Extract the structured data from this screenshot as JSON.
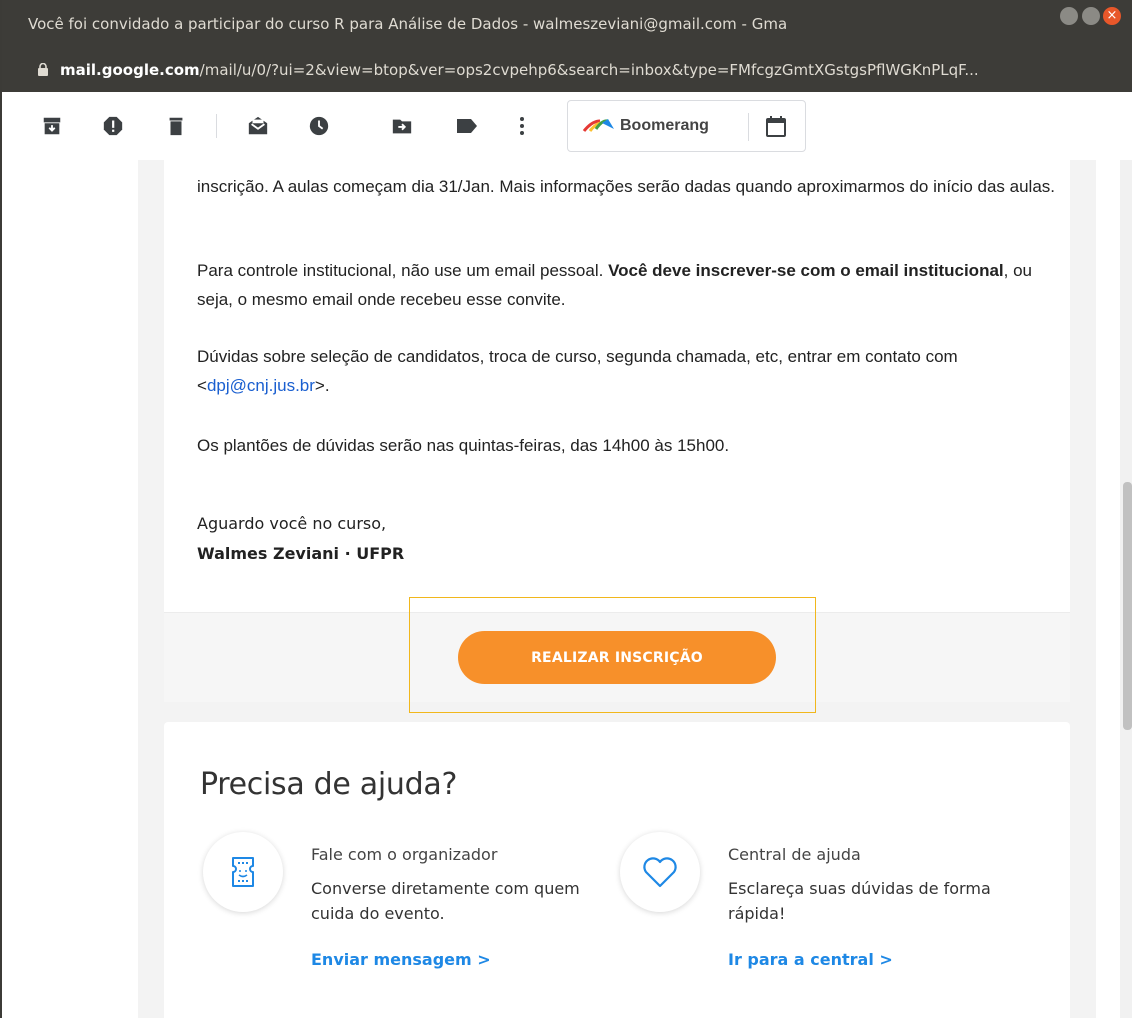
{
  "window": {
    "title": "Você foi convidado a participar do curso R para Análise de Dados - walmeszeviani@gmail.com - Gma",
    "close_glyph": "×"
  },
  "urlbar": {
    "domain": "mail.google.com",
    "path": "/mail/u/0/?ui=2&view=btop&ver=ops2cvpehp6&search=inbox&type=FMfcgzGmtXGstgsPflWGKnPLqF..."
  },
  "toolbar": {
    "icons": [
      "archive-icon",
      "report-spam-icon",
      "delete-icon",
      "mark-unread-icon",
      "snooze-icon",
      "move-to-icon",
      "label-icon",
      "more-vert-icon"
    ],
    "boomerang_label": "Boomerang"
  },
  "email": {
    "paragraph1": "inscrição. A aulas começam dia 31/Jan. Mais informações serão dadas quando aproximarmos do início das aulas.",
    "paragraph2_pre": "Para controle institucional, não use um email pessoal. ",
    "paragraph2_bold": "Você deve inscrever-se com o email institucional",
    "paragraph2_post": ", ou seja, o mesmo email onde recebeu esse convite.",
    "paragraph3_pre": "Dúvidas sobre seleção de candidatos, troca de curso, segunda chamada, etc, entrar em contato com <",
    "paragraph3_link": "dpj@cnj.jus.br",
    "paragraph3_post": ">.",
    "paragraph4": "Os plantões de dúvidas serão nas quintas-feiras, das 14h00 às 15h00.",
    "closing": "Aguardo você no curso,",
    "signature": "Walmes Zeviani · UFPR",
    "cta_label": "REALIZAR INSCRIÇÃO",
    "accent_color": "#f7902a"
  },
  "help": {
    "title": "Precisa de ajuda?",
    "organizer": {
      "heading": "Fale com o organizador",
      "description": "Converse diretamente com quem cuida do evento.",
      "link": "Enviar mensagem >"
    },
    "central": {
      "heading": "Central de ajuda",
      "description": "Esclareça suas dúvidas de forma rápida!",
      "link": "Ir para a central >"
    },
    "link_color": "#1e88e5"
  }
}
